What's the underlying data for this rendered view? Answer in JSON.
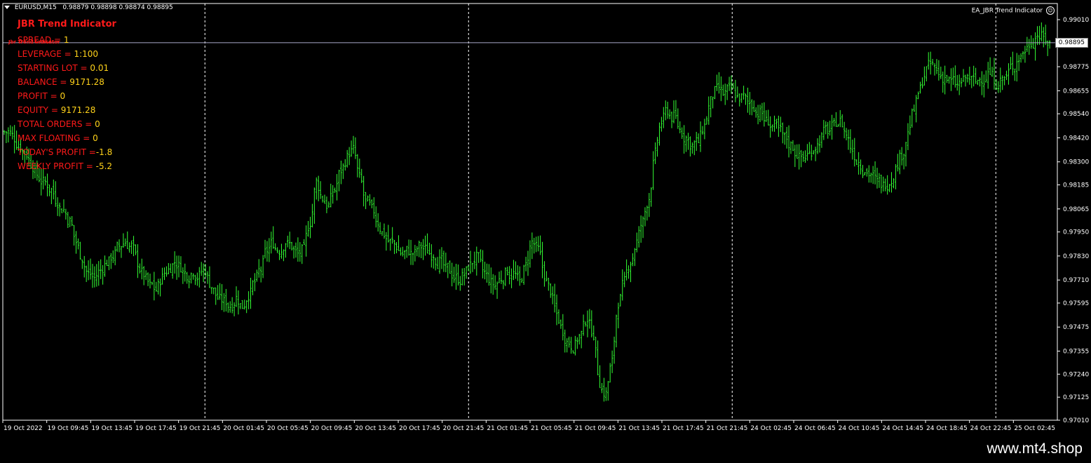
{
  "header": {
    "symbol": "EURUSD,M15",
    "ohlc": "0.98879 0.98898 0.98874 0.98895",
    "ea_name": "EA_JBR Trend Indicator"
  },
  "panel": {
    "title": "JBR Trend Indicator",
    "tiny_label": "Jbr Trend Indicator",
    "rows": [
      {
        "label": "SPREAD = ",
        "value": "1"
      },
      {
        "label": "LEVERAGE = ",
        "value": "1:100"
      },
      {
        "label": "STARTING LOT = ",
        "value": "0.01"
      },
      {
        "label": "BALANCE = ",
        "value": "9171.28"
      },
      {
        "label": "PROFIT = ",
        "value": "0"
      },
      {
        "label": "EQUITY = ",
        "value": "9171.28"
      },
      {
        "label": "TOTAL ORDERS = ",
        "value": "0"
      },
      {
        "label": "MAX FLOATING = ",
        "value": "0"
      },
      {
        "label": "TODAY'S PROFIT =",
        "value": "-1.8"
      },
      {
        "label": "WEEKLY PROFIT = ",
        "value": "-5.2"
      }
    ]
  },
  "footer": {
    "brand": "www.mt4.shop"
  },
  "colors": {
    "bars": "#33ff33",
    "text_red": "#ff1a1a",
    "text_yellow": "#ffd21a",
    "grid": "#ffffff"
  },
  "chart_data": {
    "type": "ohlc",
    "symbol": "EURUSD",
    "timeframe": "M15",
    "current_price": "0.98895",
    "ylim": [
      0.9701,
      0.9901
    ],
    "y_ticks": [
      "0.99010",
      "0.98895",
      "0.98775",
      "0.98655",
      "0.98540",
      "0.98420",
      "0.98300",
      "0.98185",
      "0.98065",
      "0.97950",
      "0.97830",
      "0.97710",
      "0.97595",
      "0.97475",
      "0.97355",
      "0.97240",
      "0.97125",
      "0.97010"
    ],
    "x_ticks": [
      "19 Oct 2022",
      "19 Oct 09:45",
      "19 Oct 13:45",
      "19 Oct 17:45",
      "19 Oct 21:45",
      "20 Oct 01:45",
      "20 Oct 05:45",
      "20 Oct 09:45",
      "20 Oct 13:45",
      "20 Oct 17:45",
      "20 Oct 21:45",
      "21 Oct 01:45",
      "21 Oct 05:45",
      "21 Oct 09:45",
      "21 Oct 13:45",
      "21 Oct 17:45",
      "21 Oct 21:45",
      "24 Oct 02:45",
      "24 Oct 06:45",
      "24 Oct 10:45",
      "24 Oct 14:45",
      "24 Oct 18:45",
      "24 Oct 22:45",
      "25 Oct 02:45"
    ],
    "day_separators_after": [
      "19 Oct 21:45",
      "20 Oct 21:45",
      "21 Oct 21:45",
      "24 Oct 22:45"
    ],
    "series_close": [
      0.9845,
      0.9842,
      0.9838,
      0.9834,
      0.9828,
      0.9822,
      0.982,
      0.9816,
      0.981,
      0.9806,
      0.98,
      0.979,
      0.9782,
      0.9774,
      0.9772,
      0.9776,
      0.978,
      0.9783,
      0.9788,
      0.979,
      0.9788,
      0.978,
      0.9774,
      0.9768,
      0.9766,
      0.9772,
      0.9776,
      0.978,
      0.9778,
      0.9774,
      0.9776,
      0.9773,
      0.9776,
      0.9768,
      0.9762,
      0.976,
      0.9758,
      0.9762,
      0.9758,
      0.9764,
      0.977,
      0.9776,
      0.9786,
      0.979,
      0.9786,
      0.979,
      0.9788,
      0.9784,
      0.9786,
      0.98,
      0.982,
      0.9812,
      0.9808,
      0.9816,
      0.9826,
      0.9832,
      0.9836,
      0.9822,
      0.981,
      0.9806,
      0.98,
      0.9794,
      0.979,
      0.9788,
      0.9784,
      0.9786,
      0.9784,
      0.9788,
      0.9786,
      0.9784,
      0.978,
      0.9776,
      0.9774,
      0.9772,
      0.9774,
      0.9778,
      0.9782,
      0.9776,
      0.9772,
      0.9768,
      0.9772,
      0.9776,
      0.9774,
      0.977,
      0.9778,
      0.979,
      0.9786,
      0.9774,
      0.9766,
      0.9754,
      0.9746,
      0.974,
      0.9738,
      0.9744,
      0.9752,
      0.9744,
      0.972,
      0.9714,
      0.973,
      0.976,
      0.977,
      0.978,
      0.979,
      0.98,
      0.9812,
      0.9834,
      0.985,
      0.9856,
      0.9852,
      0.9846,
      0.9842,
      0.9838,
      0.984,
      0.9848,
      0.986,
      0.9866,
      0.9864,
      0.9866,
      0.9864,
      0.9862,
      0.986,
      0.9858,
      0.9854,
      0.985,
      0.9848,
      0.9846,
      0.9842,
      0.9838,
      0.9834,
      0.9832,
      0.9834,
      0.9838,
      0.9842,
      0.9846,
      0.9848,
      0.985,
      0.9844,
      0.9836,
      0.983,
      0.9826,
      0.9824,
      0.982,
      0.9818,
      0.982,
      0.9826,
      0.9834,
      0.9844,
      0.9856,
      0.9866,
      0.9876,
      0.9878,
      0.9874,
      0.9872,
      0.987,
      0.9868,
      0.987,
      0.9872,
      0.987,
      0.9872,
      0.9874,
      0.9872,
      0.987,
      0.9872,
      0.9878,
      0.9882,
      0.9886,
      0.989,
      0.9894,
      0.9892,
      0.9889
    ]
  }
}
